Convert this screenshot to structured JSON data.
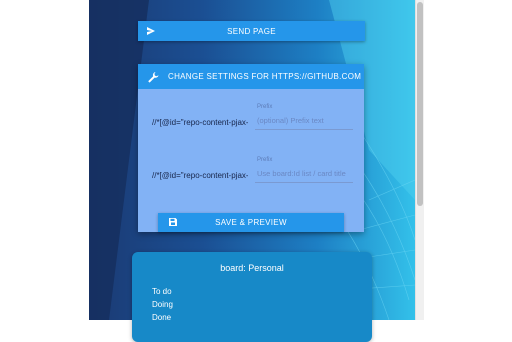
{
  "toolbar": {
    "send_label": "SEND PAGE"
  },
  "settings": {
    "header": "CHANGE SETTINGS FOR HTTPS://GITHUB.COM",
    "rows": [
      {
        "xpath": "//*[@id=\"repo-content-pjax-container\"]",
        "field_label": "Prefix",
        "value": "",
        "placeholder": "(optional) Prefix text"
      },
      {
        "xpath": "//*[@id=\"repo-content-pjax-container\"]",
        "field_label": "Prefix",
        "value": "",
        "placeholder": "Use board:Id list / card title"
      }
    ],
    "save_label": "SAVE & PREVIEW"
  },
  "board": {
    "title": "board: Personal",
    "lists": [
      "To do",
      "Doing",
      "Done"
    ]
  },
  "icons": {
    "send": "send-icon",
    "settings": "wrench-icon",
    "save": "save-icon"
  },
  "colors": {
    "accent": "#2596ea",
    "panel": "#82b2f5",
    "board": "#1789c8"
  }
}
